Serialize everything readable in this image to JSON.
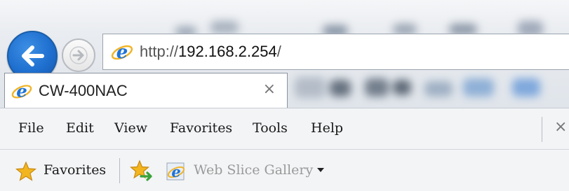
{
  "navigation": {
    "back_icon": "back-arrow-icon",
    "forward_icon": "forward-arrow-icon"
  },
  "address_bar": {
    "scheme": "http://",
    "host": "192.168.2.254",
    "path": "/",
    "icon": "ie-page-icon"
  },
  "tab": {
    "title": "CW-400NAC",
    "close_glyph": "×",
    "icon": "ie-page-icon"
  },
  "menu": {
    "items": [
      {
        "label": "File"
      },
      {
        "label": "Edit"
      },
      {
        "label": "View"
      },
      {
        "label": "Favorites"
      },
      {
        "label": "Tools"
      },
      {
        "label": "Help"
      }
    ],
    "close_glyph": "×"
  },
  "favorites_bar": {
    "favorites_label": "Favorites",
    "favorites_icon": "star-icon",
    "add_icon": "add-to-favorites-bar-icon",
    "web_slice_label": "Web Slice Gallery",
    "web_slice_icon": "ie-web-slice-icon"
  },
  "colors": {
    "back_button": "#1f6fcf",
    "star": "#f2b51f",
    "ie_blue": "#1e73d6"
  }
}
